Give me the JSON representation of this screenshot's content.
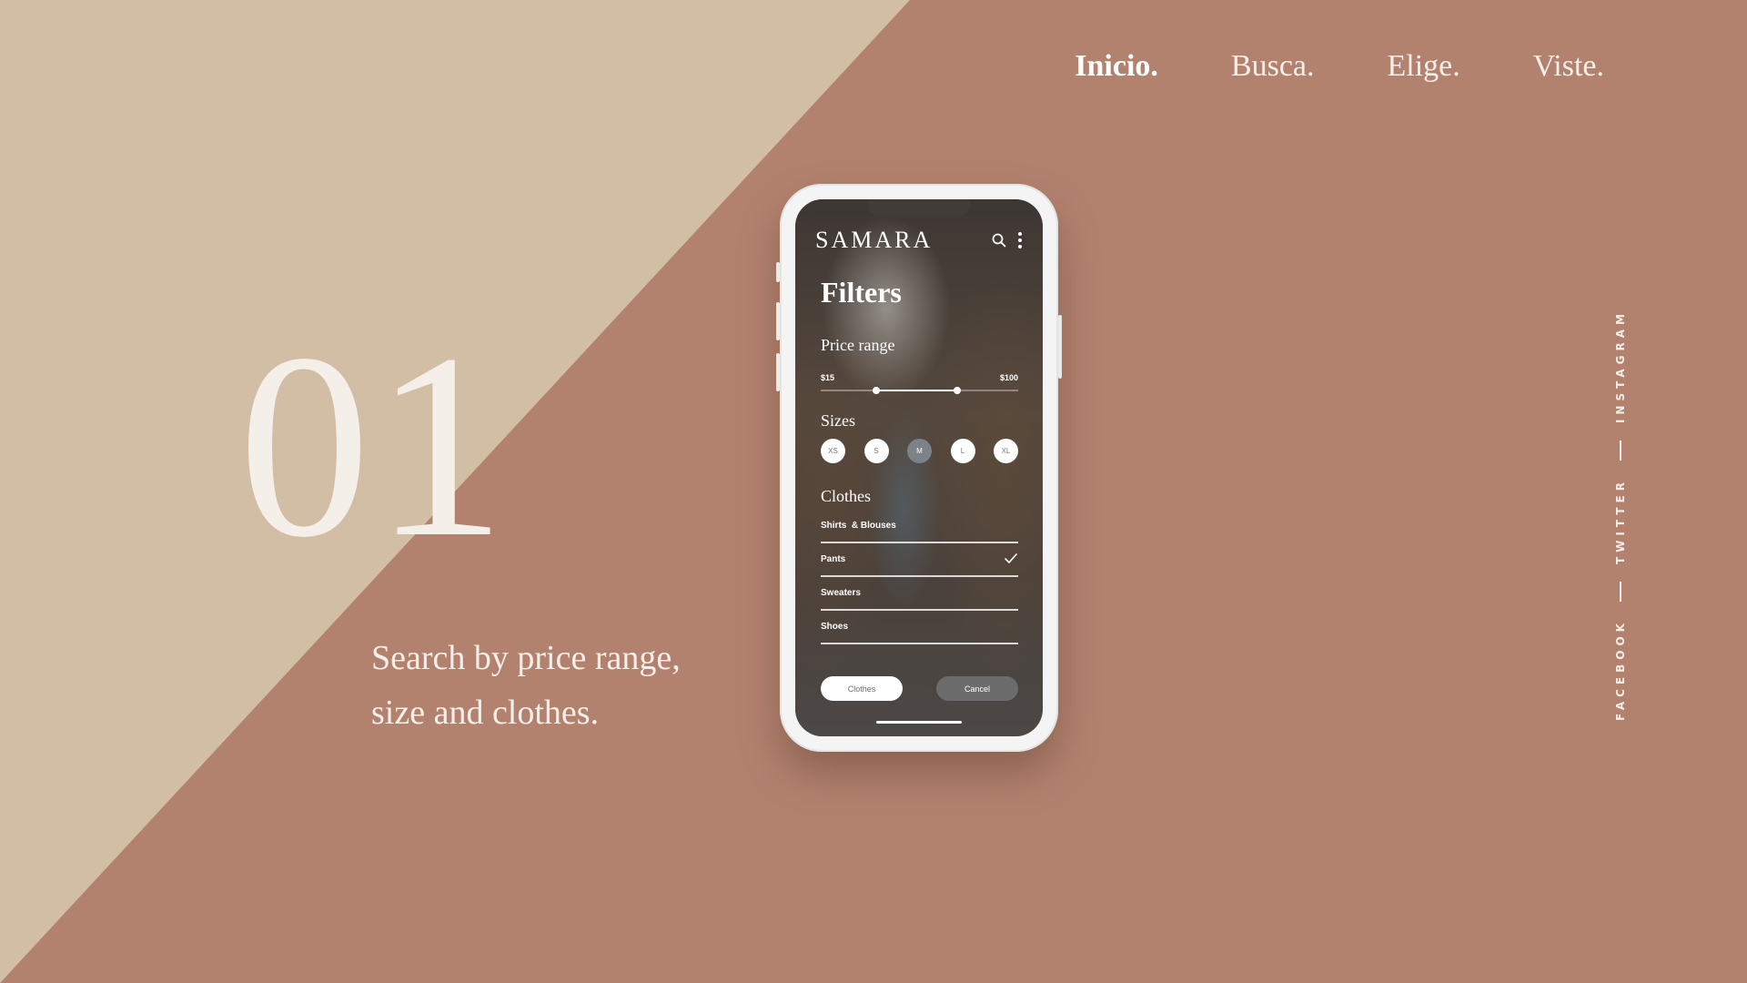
{
  "nav": {
    "items": [
      {
        "label": "Inicio.",
        "active": true
      },
      {
        "label": "Busca.",
        "active": false
      },
      {
        "label": "Elige.",
        "active": false
      },
      {
        "label": "Viste.",
        "active": false
      }
    ]
  },
  "hero": {
    "number": "01",
    "tagline_line1": "Search by price range,",
    "tagline_line2": "size and clothes."
  },
  "social": {
    "links": [
      "FACEBOOK",
      "TWITTER",
      "INSTAGRAM"
    ]
  },
  "app": {
    "brand": "SAMARA",
    "header_icons": [
      "search-icon",
      "more-vertical-icon"
    ],
    "title": "Filters",
    "price": {
      "label": "Price range",
      "min_label": "$15",
      "max_label": "$100",
      "selected_low_fraction": 0.28,
      "selected_high_fraction": 0.69
    },
    "sizes": {
      "label": "Sizes",
      "options": [
        "XS",
        "S",
        "M",
        "L",
        "XL"
      ],
      "selected": "M"
    },
    "clothes": {
      "label": "Clothes",
      "items": [
        {
          "label": "Shirts  & Blouses",
          "checked": false
        },
        {
          "label": "Pants",
          "checked": true
        },
        {
          "label": "Sweaters",
          "checked": false
        },
        {
          "label": "Shoes",
          "checked": false
        }
      ]
    },
    "buttons": {
      "primary": "Clothes",
      "secondary": "Cancel"
    }
  },
  "colors": {
    "background": "#b3826f",
    "diagonal_panel": "#d2bda5",
    "text_light": "#f6eee8",
    "size_selected": "#7d8289"
  }
}
